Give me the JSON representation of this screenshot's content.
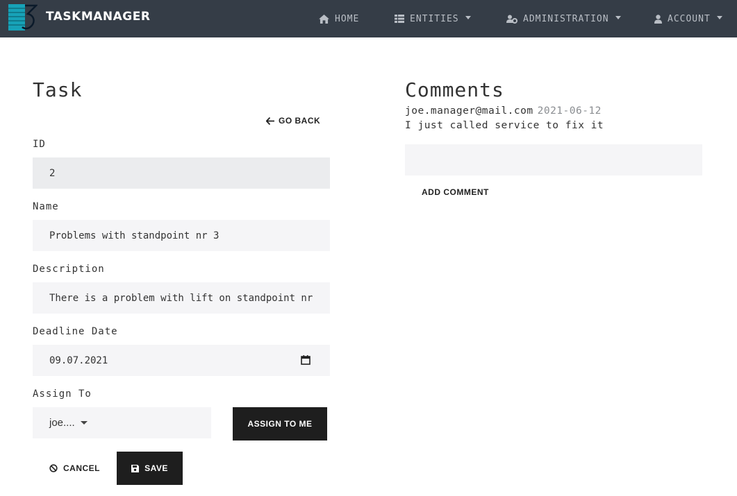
{
  "navbar": {
    "brand": "TASKMANAGER",
    "items": [
      {
        "label": "HOME",
        "icon": "home-icon"
      },
      {
        "label": "ENTITIES",
        "icon": "th-list-icon"
      },
      {
        "label": "ADMINISTRATION",
        "icon": "users-cog-icon"
      },
      {
        "label": "ACCOUNT",
        "icon": "user-icon"
      }
    ]
  },
  "task": {
    "title": "Task",
    "go_back": "GO BACK",
    "id_label": "ID",
    "id_value": "2",
    "name_label": "Name",
    "name_value": "Problems with standpoint nr 3",
    "description_label": "Description",
    "description_value": "There is a problem with lift on standpoint nr",
    "deadline_label": "Deadline Date",
    "deadline_value": "09.07.2021",
    "assign_label": "Assign To",
    "assign_value": "joe....",
    "assign_to_me": "ASSIGN TO ME",
    "cancel": "CANCEL",
    "save": "SAVE"
  },
  "comments": {
    "title": "Comments",
    "items": [
      {
        "author": "joe.manager@mail.com",
        "date": "2021-06-12",
        "text": "I just called service to fix it"
      }
    ],
    "input_value": "",
    "add_comment": "ADD COMMENT"
  },
  "colors": {
    "navbar_bg": "#353d47",
    "field_bg": "#f5f5f7",
    "readonly_bg": "#ebecee",
    "button_dark": "#1e1e1e",
    "logo_teal": "#17a2b8"
  }
}
